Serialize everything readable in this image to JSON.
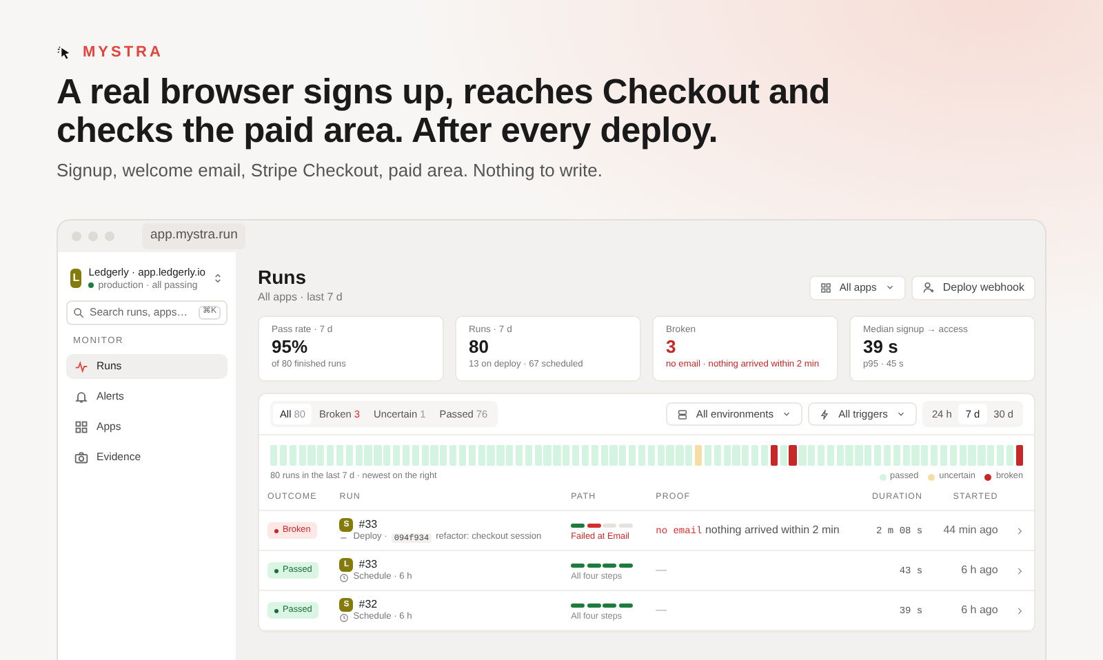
{
  "brand": {
    "name": "MYSTRA"
  },
  "headline": "A real browser signs up, reaches Checkout and checks the paid area. After every deploy.",
  "subtitle": "Signup, welcome email, Stripe Checkout, paid area. Nothing to write.",
  "browser": {
    "url": "app.mystra.run"
  },
  "sidebar": {
    "workspace": {
      "initial": "L",
      "name": "Ledgerly · app.ledgerly.io",
      "status": "production · all passing"
    },
    "search": {
      "placeholder": "Search runs, apps…",
      "shortcut": "⌘K"
    },
    "section": "MONITOR",
    "items": [
      {
        "label": "Runs",
        "selected": true
      },
      {
        "label": "Alerts",
        "selected": false
      },
      {
        "label": "Apps",
        "selected": false
      },
      {
        "label": "Evidence",
        "selected": false
      }
    ]
  },
  "main": {
    "title": "Runs",
    "subtitle": "All apps · last 7 d",
    "app_filter": "All apps",
    "webhook_button": "Deploy webhook",
    "stats": [
      {
        "label": "Pass rate · 7 d",
        "value": "95%",
        "note": "of 80 finished runs",
        "kind": "normal"
      },
      {
        "label": "Runs · 7 d",
        "value": "80",
        "note": "13 on deploy · 67 scheduled",
        "kind": "normal"
      },
      {
        "label": "Broken",
        "value": "3",
        "note": "no email · nothing arrived within 2 min",
        "kind": "alert"
      },
      {
        "label": "Median signup → access",
        "value": "39 s",
        "note": "p95 · 45 s",
        "kind": "normal"
      }
    ],
    "filter_tabs": [
      {
        "label": "All",
        "count": "80",
        "selected": true,
        "kind": "all"
      },
      {
        "label": "Broken",
        "count": "3",
        "selected": false,
        "kind": "broken"
      },
      {
        "label": "Uncertain",
        "count": "1",
        "selected": false,
        "kind": "uncertain"
      },
      {
        "label": "Passed",
        "count": "76",
        "selected": false,
        "kind": "passed"
      }
    ],
    "environment_filter": "All environments",
    "trigger_filter": "All triggers",
    "ranges": [
      {
        "label": "24 h",
        "selected": false
      },
      {
        "label": "7 d",
        "selected": true
      },
      {
        "label": "30 d",
        "selected": false
      }
    ],
    "timeline": {
      "runs": [
        {
          "color": "#d4f3e0"
        },
        {
          "color": "#d4f3e0"
        },
        {
          "color": "#d4f3e0"
        },
        {
          "color": "#d4f3e0"
        },
        {
          "color": "#d4f3e0"
        },
        {
          "color": "#d4f3e0"
        },
        {
          "color": "#d4f3e0"
        },
        {
          "color": "#d4f3e0"
        },
        {
          "color": "#d4f3e0"
        },
        {
          "color": "#d4f3e0"
        },
        {
          "color": "#d4f3e0"
        },
        {
          "color": "#d4f3e0"
        },
        {
          "color": "#d4f3e0"
        },
        {
          "color": "#d4f3e0"
        },
        {
          "color": "#d4f3e0"
        },
        {
          "color": "#d4f3e0"
        },
        {
          "color": "#d4f3e0"
        },
        {
          "color": "#d4f3e0"
        },
        {
          "color": "#d4f3e0"
        },
        {
          "color": "#d4f3e0"
        },
        {
          "color": "#d4f3e0"
        },
        {
          "color": "#d4f3e0"
        },
        {
          "color": "#d4f3e0"
        },
        {
          "color": "#d4f3e0"
        },
        {
          "color": "#d4f3e0"
        },
        {
          "color": "#d4f3e0"
        },
        {
          "color": "#d4f3e0"
        },
        {
          "color": "#d4f3e0"
        },
        {
          "color": "#d4f3e0"
        },
        {
          "color": "#d4f3e0"
        },
        {
          "color": "#d4f3e0"
        },
        {
          "color": "#d4f3e0"
        },
        {
          "color": "#d4f3e0"
        },
        {
          "color": "#d4f3e0"
        },
        {
          "color": "#d4f3e0"
        },
        {
          "color": "#d4f3e0"
        },
        {
          "color": "#d4f3e0"
        },
        {
          "color": "#d4f3e0"
        },
        {
          "color": "#d4f3e0"
        },
        {
          "color": "#d4f3e0"
        },
        {
          "color": "#d4f3e0"
        },
        {
          "color": "#d4f3e0"
        },
        {
          "color": "#d4f3e0"
        },
        {
          "color": "#d4f3e0"
        },
        {
          "color": "#d4f3e0"
        },
        {
          "color": "#f6dda6"
        },
        {
          "color": "#d4f3e0"
        },
        {
          "color": "#d4f3e0"
        },
        {
          "color": "#d4f3e0"
        },
        {
          "color": "#d4f3e0"
        },
        {
          "color": "#d4f3e0"
        },
        {
          "color": "#d4f3e0"
        },
        {
          "color": "#d4f3e0"
        },
        {
          "color": "#c62828"
        },
        {
          "color": "#d4f3e0"
        },
        {
          "color": "#c62828"
        },
        {
          "color": "#d4f3e0"
        },
        {
          "color": "#d4f3e0"
        },
        {
          "color": "#d4f3e0"
        },
        {
          "color": "#d4f3e0"
        },
        {
          "color": "#d4f3e0"
        },
        {
          "color": "#d4f3e0"
        },
        {
          "color": "#d4f3e0"
        },
        {
          "color": "#d4f3e0"
        },
        {
          "color": "#d4f3e0"
        },
        {
          "color": "#d4f3e0"
        },
        {
          "color": "#d4f3e0"
        },
        {
          "color": "#d4f3e0"
        },
        {
          "color": "#d4f3e0"
        },
        {
          "color": "#d4f3e0"
        },
        {
          "color": "#d4f3e0"
        },
        {
          "color": "#d4f3e0"
        },
        {
          "color": "#d4f3e0"
        },
        {
          "color": "#d4f3e0"
        },
        {
          "color": "#d4f3e0"
        },
        {
          "color": "#d4f3e0"
        },
        {
          "color": "#d4f3e0"
        },
        {
          "color": "#d4f3e0"
        },
        {
          "color": "#d4f3e0"
        },
        {
          "color": "#c62828"
        }
      ],
      "caption": "80 runs in the last 7 d · newest on the right",
      "legend": [
        {
          "label": "passed",
          "color": "#d4f3e0"
        },
        {
          "label": "uncertain",
          "color": "#f6dda6"
        },
        {
          "label": "broken",
          "color": "#c62828"
        }
      ]
    },
    "table": {
      "columns": [
        "OUTCOME",
        "RUN",
        "PATH",
        "PROOF",
        "DURATION",
        "STARTED"
      ],
      "rows": [
        {
          "kind": "broken",
          "outcome_label": "Broken",
          "app_initial": "S",
          "run": "#33",
          "trigger": {
            "kind": "deploy",
            "text": "Deploy ·"
          },
          "commit": "094f934",
          "commit_message": "refactor: checkout session",
          "path": [
            {
              "color": "#1e7a3d"
            },
            {
              "color": "#d32f2f"
            },
            {
              "color": "#e5e2df"
            },
            {
              "color": "#e5e2df"
            }
          ],
          "path_label": "Failed at Email",
          "proof_code": "no email",
          "proof_text": "nothing arrived within 2 min",
          "duration": "2 m 08 s",
          "started": "44 min ago"
        },
        {
          "kind": "passed",
          "outcome_label": "Passed",
          "app_initial": "L",
          "run": "#33",
          "trigger": {
            "kind": "schedule",
            "text": "Schedule · 6 h"
          },
          "path": [
            {
              "color": "#1e7a3d"
            },
            {
              "color": "#1e7a3d"
            },
            {
              "color": "#1e7a3d"
            },
            {
              "color": "#1e7a3d"
            }
          ],
          "path_label": "All four steps",
          "proof_text": "—",
          "duration": "43 s",
          "started": "6 h ago"
        },
        {
          "kind": "passed",
          "outcome_label": "Passed",
          "app_initial": "S",
          "run": "#32",
          "trigger": {
            "kind": "schedule",
            "text": "Schedule · 6 h"
          },
          "path": [
            {
              "color": "#1e7a3d"
            },
            {
              "color": "#1e7a3d"
            },
            {
              "color": "#1e7a3d"
            },
            {
              "color": "#1e7a3d"
            }
          ],
          "path_label": "All four steps",
          "proof_text": "—",
          "duration": "39 s",
          "started": "6 h ago"
        }
      ]
    }
  }
}
